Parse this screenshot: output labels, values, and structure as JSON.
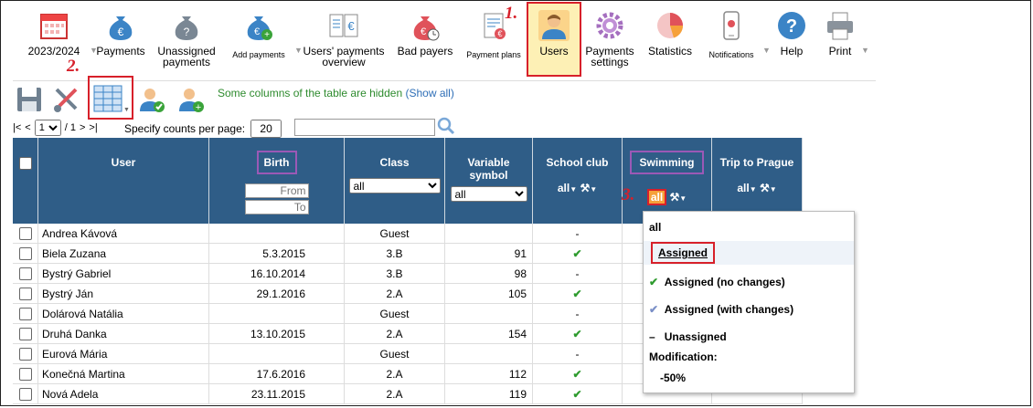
{
  "toolbar": {
    "year": "2023/2024",
    "payments": "Payments",
    "unassigned_payments": "Unassigned payments",
    "add_payments": "Add payments",
    "users_payments_overview": "Users' payments overview",
    "bad_payers": "Bad payers",
    "payment_plans": "Payment plans",
    "users": "Users",
    "payments_settings": "Payments settings",
    "statistics": "Statistics",
    "notifications": "Notifications",
    "help": "Help",
    "print": "Print"
  },
  "steps": {
    "one": "1.",
    "two": "2.",
    "three": "3."
  },
  "hidden_msg": "Some columns of the table are hidden",
  "show_all": "(Show all)",
  "pager": {
    "first": "|<",
    "prev": "<",
    "page": "1",
    "of": "/ 1",
    "next": ">",
    "last": ">|",
    "per_page_label": "Specify counts per page:",
    "per_page": "20"
  },
  "columns": {
    "user": "User",
    "birth": "Birth",
    "from_ph": "From",
    "to_ph": "To",
    "class": "Class",
    "variable_symbol": "Variable symbol",
    "school_club": "School club",
    "swimming": "Swimming",
    "trip": "Trip to Prague",
    "all": "all"
  },
  "rows": [
    {
      "name": "Andrea Kávová",
      "birth": "",
      "class": "Guest",
      "vs": "",
      "club": "-"
    },
    {
      "name": "Biela Zuzana",
      "birth": "5.3.2015",
      "class": "3.B",
      "vs": "91",
      "club": "✔"
    },
    {
      "name": "Bystrý Gabriel",
      "birth": "16.10.2014",
      "class": "3.B",
      "vs": "98",
      "club": "-"
    },
    {
      "name": "Bystrý Ján",
      "birth": "29.1.2016",
      "class": "2.A",
      "vs": "105",
      "club": "✔"
    },
    {
      "name": "Dolárová Natália",
      "birth": "",
      "class": "Guest",
      "vs": "",
      "club": "-"
    },
    {
      "name": "Druhá Danka",
      "birth": "13.10.2015",
      "class": "2.A",
      "vs": "154",
      "club": "✔"
    },
    {
      "name": "Eurová Mária",
      "birth": "",
      "class": "Guest",
      "vs": "",
      "club": "-"
    },
    {
      "name": "Konečná Martina",
      "birth": "17.6.2016",
      "class": "2.A",
      "vs": "112",
      "club": "✔"
    },
    {
      "name": "Nová Adela",
      "birth": "23.11.2015",
      "class": "2.A",
      "vs": "119",
      "club": "✔"
    }
  ],
  "dropdown": {
    "all": "all",
    "assigned": "Assigned",
    "assigned_no_changes": "Assigned (no changes)",
    "assigned_with_changes": "Assigned (with changes)",
    "unassigned": "Unassigned",
    "modification": "Modification:",
    "minus50": "-50%"
  }
}
